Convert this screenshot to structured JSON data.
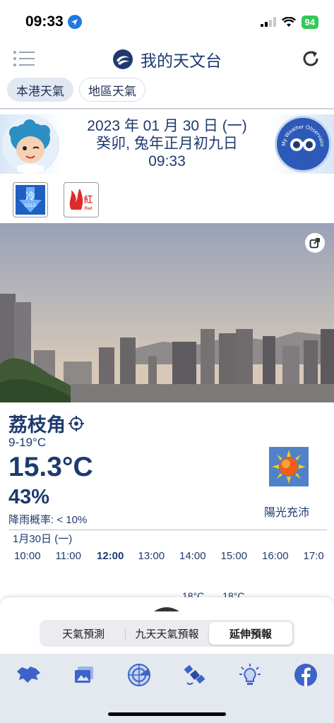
{
  "status_bar": {
    "time": "09:33",
    "battery": "94"
  },
  "header": {
    "title": "我的天文台"
  },
  "tabs": [
    {
      "label": "本港天氣",
      "active": true
    },
    {
      "label": "地區天氣",
      "active": false
    }
  ],
  "date_block": {
    "gregorian": "2023 年 01 月 30 日 (一)",
    "lunar": "癸卯, 兔年正月初九日",
    "time": "09:33"
  },
  "observation_badge": {
    "text": "My Weather Observation 我的天氣觀察"
  },
  "warnings": [
    {
      "name": "cold-warning",
      "label": "冷",
      "sub": "COLD"
    },
    {
      "name": "red-fire-danger-warning",
      "label": "紅",
      "sub": "Red"
    }
  ],
  "current": {
    "station": "荔枝角",
    "range": "9-19°C",
    "temperature": "15.3°C",
    "humidity": "43%",
    "rain_probability": "降雨概率: < 10%",
    "weather_description": "陽光充沛",
    "weather_icon": "sunny-icon"
  },
  "forecast": {
    "date": "1月30日 (一)",
    "hours": [
      "10:00",
      "11:00",
      "12:00",
      "13:00",
      "14:00",
      "15:00",
      "16:00",
      "17:0"
    ],
    "highlight_hour": "12:00",
    "peek_values": [
      "18°C",
      "18°C"
    ]
  },
  "bottom_sheet": {
    "segments": [
      "天氣預測",
      "九天天氣預報",
      "延伸預報"
    ],
    "selected": "延伸預報"
  },
  "bottom_nav": [
    "hong-kong-map-icon",
    "photo-gallery-icon",
    "radar-icon",
    "satellite-icon",
    "lightbulb-icon",
    "facebook-icon"
  ],
  "colors": {
    "primary": "#1e3a6e",
    "accent": "#2d5ab8",
    "nav_bg": "#e4e8ef"
  }
}
